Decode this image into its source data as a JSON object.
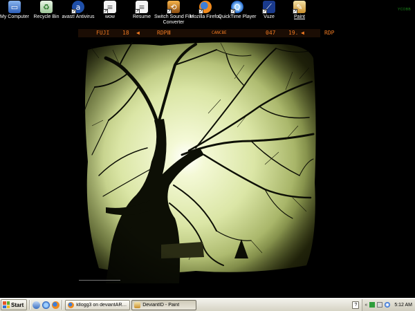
{
  "desktop": {
    "icons": [
      {
        "label": "My Computer",
        "icon": "my-computer-icon"
      },
      {
        "label": "Recycle Bin",
        "icon": "recycle-bin-icon"
      },
      {
        "label": "avast! Antivirus",
        "icon": "avast-icon"
      },
      {
        "label": "wow",
        "icon": "wow-shortcut-icon"
      },
      {
        "label": "Resume",
        "icon": "resume-document-icon"
      },
      {
        "label": "Switch Sound File Converter",
        "icon": "switch-sound-icon"
      },
      {
        "label": "Mozilla Firefox",
        "icon": "firefox-icon"
      },
      {
        "label": "QuickTime Player",
        "icon": "quicktime-icon"
      },
      {
        "label": "Vuze",
        "icon": "vuze-icon"
      },
      {
        "label": "Paint",
        "icon": "paint-icon"
      }
    ],
    "selected_icon": "Paint",
    "corner_text": "YCOBB"
  },
  "wallpaper": {
    "film_brand": "FUJI",
    "frame_left": "18",
    "film_type_left": "RDPⅢ",
    "center_code": "CANCBE",
    "frame_code": "047",
    "frame_right": "19.",
    "film_type_right": "RDP"
  },
  "taskbar": {
    "start_label": "Start",
    "quick_launch": [
      "show-desktop-icon",
      "internet-explorer-icon",
      "firefox-icon"
    ],
    "tasks": [
      {
        "label": "kllogg3 on deviantART - ...",
        "icon": "firefox-icon",
        "active": false
      },
      {
        "label": "DeviantID - Paint",
        "icon": "paint-icon",
        "active": true
      }
    ],
    "tray_icons": [
      "help-icon",
      "show-hidden-icons-icon",
      "network-icon",
      "volume-icon",
      "security-icon"
    ],
    "clock": "5:12 AM"
  },
  "colors": {
    "film_text": "#f07a22",
    "taskbar_bg": "#d6d3c4",
    "photo_tint": "#e6efb6"
  }
}
